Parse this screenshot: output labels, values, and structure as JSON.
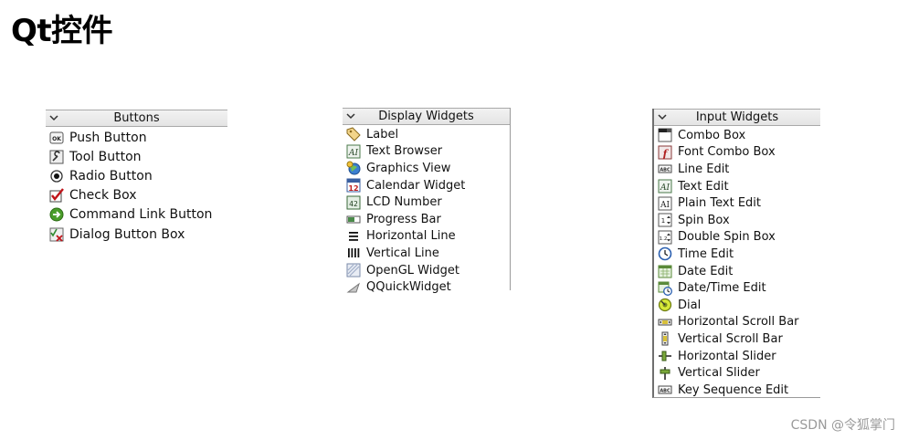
{
  "page": {
    "title": "Qt控件"
  },
  "colors": {
    "header_bg": "#e8e8e8",
    "border": "#a9a9a9",
    "watermark": "#9a9a9a"
  },
  "panels": {
    "buttons": {
      "header": "Buttons",
      "items": [
        {
          "label": "Push Button",
          "icon": "push-button-icon"
        },
        {
          "label": "Tool Button",
          "icon": "tool-button-icon"
        },
        {
          "label": "Radio Button",
          "icon": "radio-button-icon"
        },
        {
          "label": "Check Box",
          "icon": "check-box-icon"
        },
        {
          "label": "Command Link Button",
          "icon": "command-link-button-icon"
        },
        {
          "label": "Dialog Button Box",
          "icon": "dialog-button-box-icon"
        }
      ]
    },
    "display": {
      "header": "Display Widgets",
      "items": [
        {
          "label": "Label",
          "icon": "label-tag-icon"
        },
        {
          "label": "Text Browser",
          "icon": "text-browser-icon"
        },
        {
          "label": "Graphics View",
          "icon": "graphics-view-icon"
        },
        {
          "label": "Calendar Widget",
          "icon": "calendar-icon"
        },
        {
          "label": "LCD Number",
          "icon": "lcd-number-icon"
        },
        {
          "label": "Progress Bar",
          "icon": "progress-bar-icon"
        },
        {
          "label": "Horizontal Line",
          "icon": "horizontal-line-icon"
        },
        {
          "label": "Vertical Line",
          "icon": "vertical-line-icon"
        },
        {
          "label": "OpenGL Widget",
          "icon": "opengl-widget-icon"
        },
        {
          "label": "QQuickWidget",
          "icon": "qquickwidget-icon"
        }
      ]
    },
    "input": {
      "header": "Input Widgets",
      "items": [
        {
          "label": "Combo Box",
          "icon": "combo-box-icon"
        },
        {
          "label": "Font Combo Box",
          "icon": "font-combo-box-icon"
        },
        {
          "label": "Line Edit",
          "icon": "line-edit-icon"
        },
        {
          "label": "Text Edit",
          "icon": "text-edit-icon"
        },
        {
          "label": "Plain Text Edit",
          "icon": "plain-text-edit-icon"
        },
        {
          "label": "Spin Box",
          "icon": "spin-box-icon"
        },
        {
          "label": "Double Spin Box",
          "icon": "double-spin-box-icon"
        },
        {
          "label": "Time Edit",
          "icon": "clock-icon"
        },
        {
          "label": "Date Edit",
          "icon": "date-edit-icon"
        },
        {
          "label": "Date/Time Edit",
          "icon": "date-time-edit-icon"
        },
        {
          "label": "Dial",
          "icon": "dial-icon"
        },
        {
          "label": "Horizontal Scroll Bar",
          "icon": "horizontal-scroll-bar-icon"
        },
        {
          "label": "Vertical Scroll Bar",
          "icon": "vertical-scroll-bar-icon"
        },
        {
          "label": "Horizontal Slider",
          "icon": "horizontal-slider-icon"
        },
        {
          "label": "Vertical Slider",
          "icon": "vertical-slider-icon"
        },
        {
          "label": "Key Sequence Edit",
          "icon": "key-sequence-edit-icon"
        }
      ]
    }
  },
  "watermark": "CSDN @令狐掌门"
}
